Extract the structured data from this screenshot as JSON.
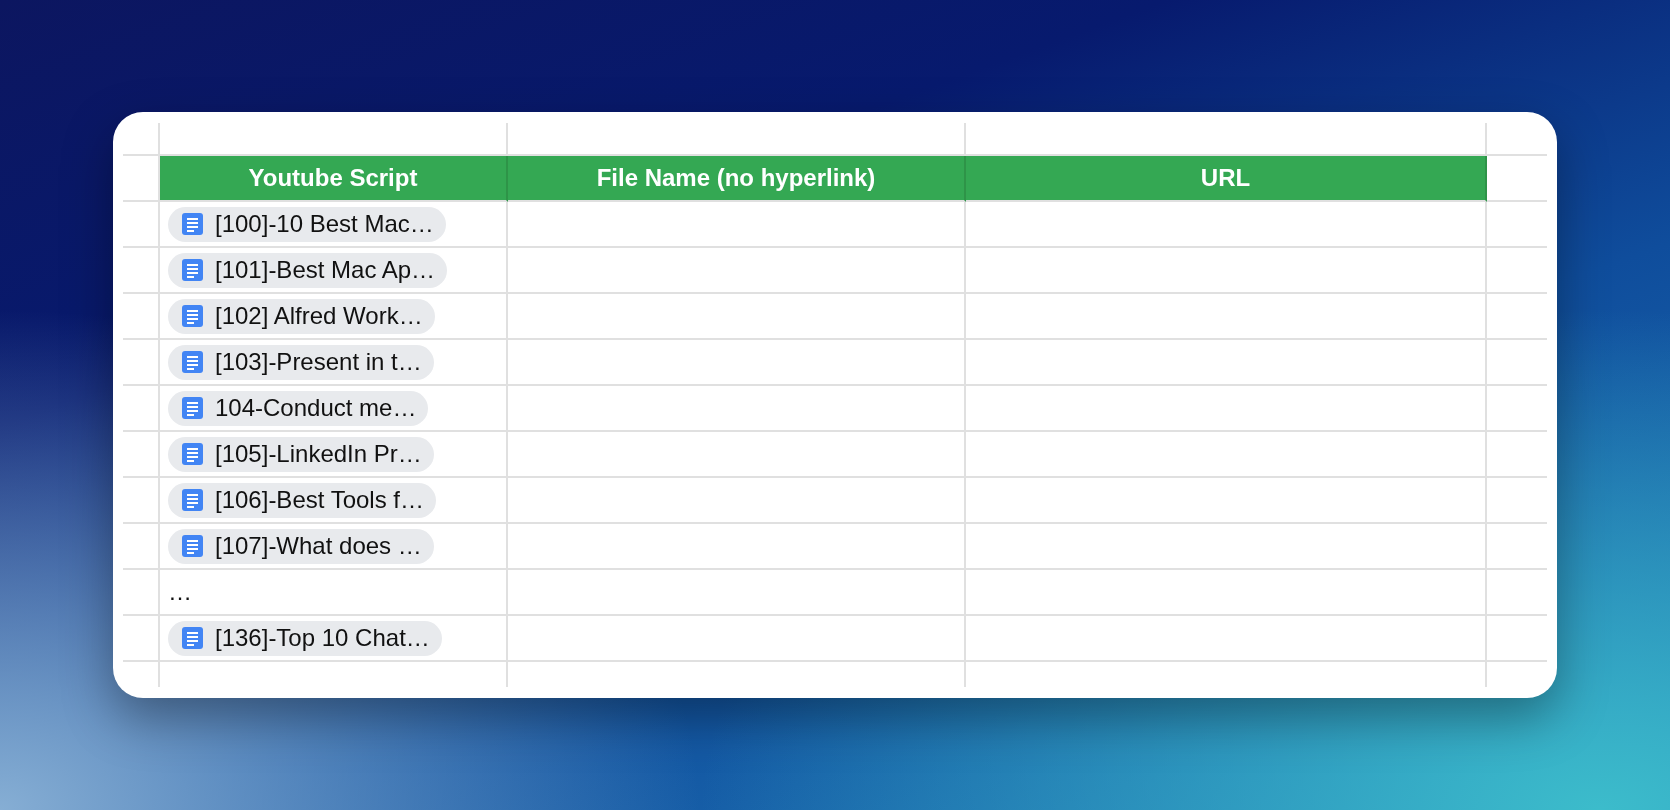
{
  "table": {
    "columns": [
      "Youtube Script",
      "File Name (no hyperlink)",
      "URL"
    ],
    "rows": [
      {
        "kind": "file",
        "text": "[100]-10 Best Mac…"
      },
      {
        "kind": "file",
        "text": "[101]-Best Mac Ap…"
      },
      {
        "kind": "file",
        "text": "[102] Alfred Work…"
      },
      {
        "kind": "file",
        "text": "[103]-Present in t…"
      },
      {
        "kind": "file",
        "text": "104-Conduct me…"
      },
      {
        "kind": "file",
        "text": "[105]-LinkedIn Pr…"
      },
      {
        "kind": "file",
        "text": "[106]-Best Tools f…"
      },
      {
        "kind": "file",
        "text": "[107]-What does …"
      },
      {
        "kind": "text",
        "text": "…"
      },
      {
        "kind": "file",
        "text": "[136]-Top 10 Chat…"
      }
    ]
  }
}
